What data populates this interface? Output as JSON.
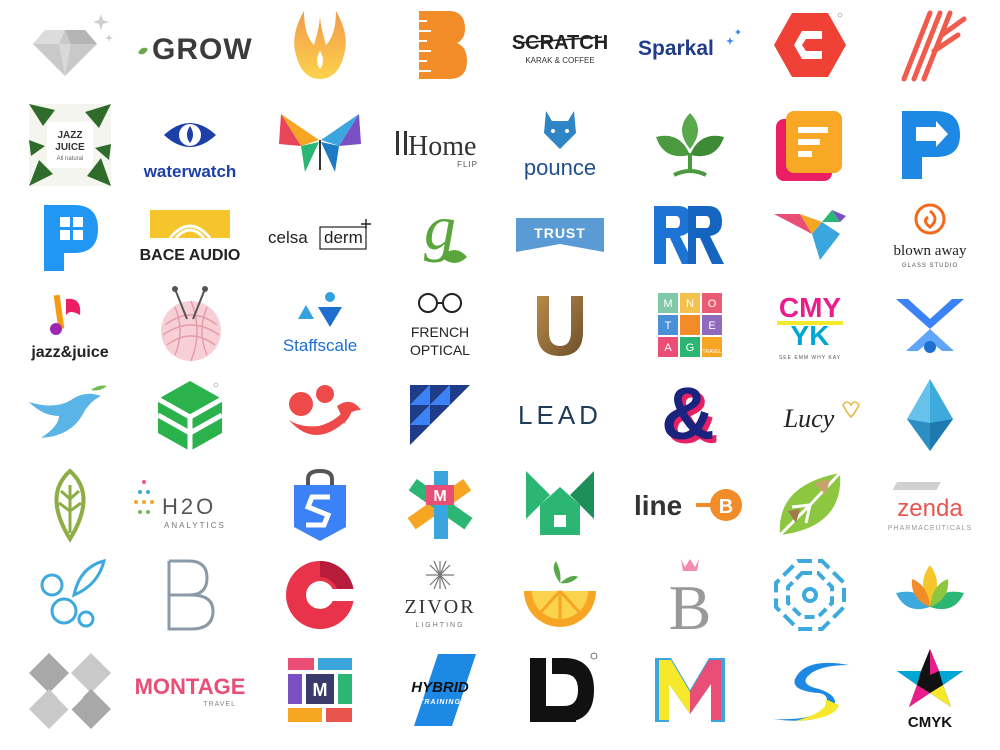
{
  "logos": {
    "grow": {
      "text": "GROW"
    },
    "scratch": {
      "title": "SCRATCH",
      "sub": "KARAK & COFFEE"
    },
    "sparkal": {
      "text": "Sparkal"
    },
    "jazz_box": {
      "l1": "JAZZ",
      "l2": "JUICE",
      "l3": "All natural"
    },
    "waterwatch": {
      "text": "waterwatch"
    },
    "homeflip": {
      "title": "Home",
      "sub": "FLIP"
    },
    "pounce": {
      "text": "pounce"
    },
    "bace": {
      "text": "BACE AUDIO"
    },
    "celsa": {
      "a": "celsa",
      "b": "derm"
    },
    "trust": {
      "text": "TRUST"
    },
    "blown": {
      "title": "blown away",
      "sub": "GLASS STUDIO"
    },
    "jazzjuice": {
      "text": "jazz&juice"
    },
    "staffscale": {
      "text": "Staffscale"
    },
    "french": {
      "l1": "FRENCH",
      "l2": "OPTICAL"
    },
    "montage_sq": {
      "letters": [
        "M",
        "N",
        "O",
        "T",
        "E",
        "A",
        "G"
      ],
      "sub": "TRAVEL"
    },
    "cmyk_sq": {
      "l1": "CMY",
      "l2": "YK",
      "sub": "SEE EMM WHY KAY"
    },
    "lead": {
      "text": "LEAD"
    },
    "lucy": {
      "text": "Lucy"
    },
    "h2o": {
      "title": "H2O",
      "sub": "ANALYTICS"
    },
    "lineb": {
      "text": "line",
      "b": "B"
    },
    "zenda": {
      "title": "zenda",
      "sub": "PHARMACEUTICALS"
    },
    "zivor": {
      "title": "ZIVOR",
      "sub": "LIGHTING"
    },
    "montage": {
      "title": "MONTAGE",
      "sub": "TRAVEL"
    },
    "hybrid": {
      "title": "HYBRID",
      "sub": "TRAINING"
    },
    "cmyk": {
      "text": "CMYK"
    }
  }
}
